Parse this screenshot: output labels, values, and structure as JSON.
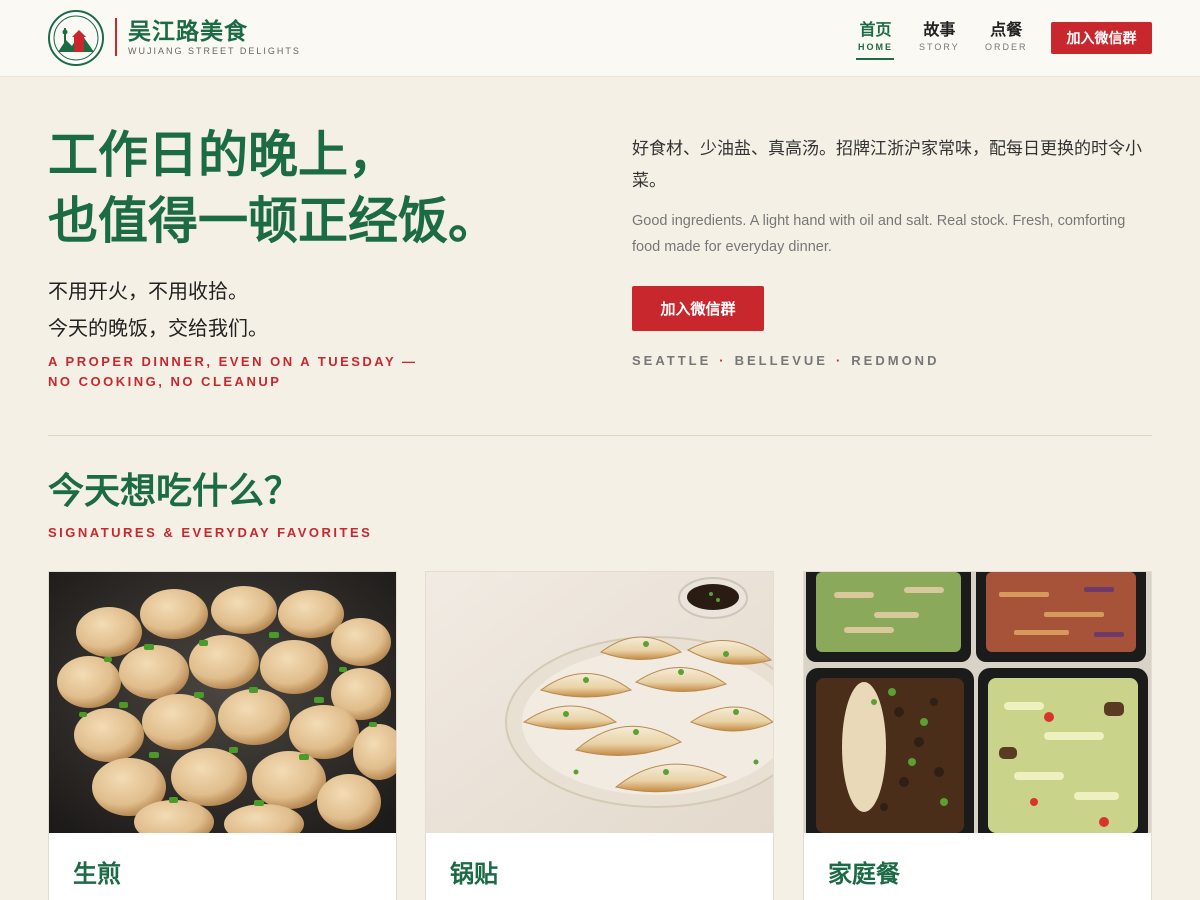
{
  "brand": {
    "name_cn": "吴江路美食",
    "name_en": "WUJIANG STREET DELIGHTS"
  },
  "nav": {
    "items": [
      {
        "cn": "首页",
        "en": "HOME",
        "active": true
      },
      {
        "cn": "故事",
        "en": "STORY",
        "active": false
      },
      {
        "cn": "点餐",
        "en": "ORDER",
        "active": false
      }
    ],
    "cta": "加入微信群"
  },
  "hero": {
    "title_line1": "工作日的晚上，",
    "title_line2": "也值得一顿正经饭。",
    "sub_line1": "不用开火，不用收拾。",
    "sub_line2": "今天的晚饭，交给我们。",
    "tag_line1": "A PROPER DINNER, EVEN ON A TUESDAY —",
    "tag_line2": "NO COOKING, NO CLEANUP",
    "desc_cn": "好食材、少油盐、真高汤。招牌江浙沪家常味，配每日更换的时令小菜。",
    "desc_en": "Good ingredients. A light hand with oil and salt. Real stock. Fresh, comforting food made for everyday dinner.",
    "cta": "加入微信群",
    "cities": [
      "SEATTLE",
      "BELLEVUE",
      "REDMOND"
    ],
    "city_separator": "·"
  },
  "menu_section": {
    "title": "今天想吃什么？",
    "tag": "SIGNATURES & EVERYDAY FAVORITES",
    "cards": [
      {
        "title": "生煎",
        "image": "pan-fried-buns-photo"
      },
      {
        "title": "锅贴",
        "image": "potstickers-photo"
      },
      {
        "title": "家庭餐",
        "image": "family-meal-boxes-photo"
      }
    ]
  },
  "colors": {
    "green": "#1b6b45",
    "red": "#c8282d",
    "background": "#f5f0e6"
  }
}
